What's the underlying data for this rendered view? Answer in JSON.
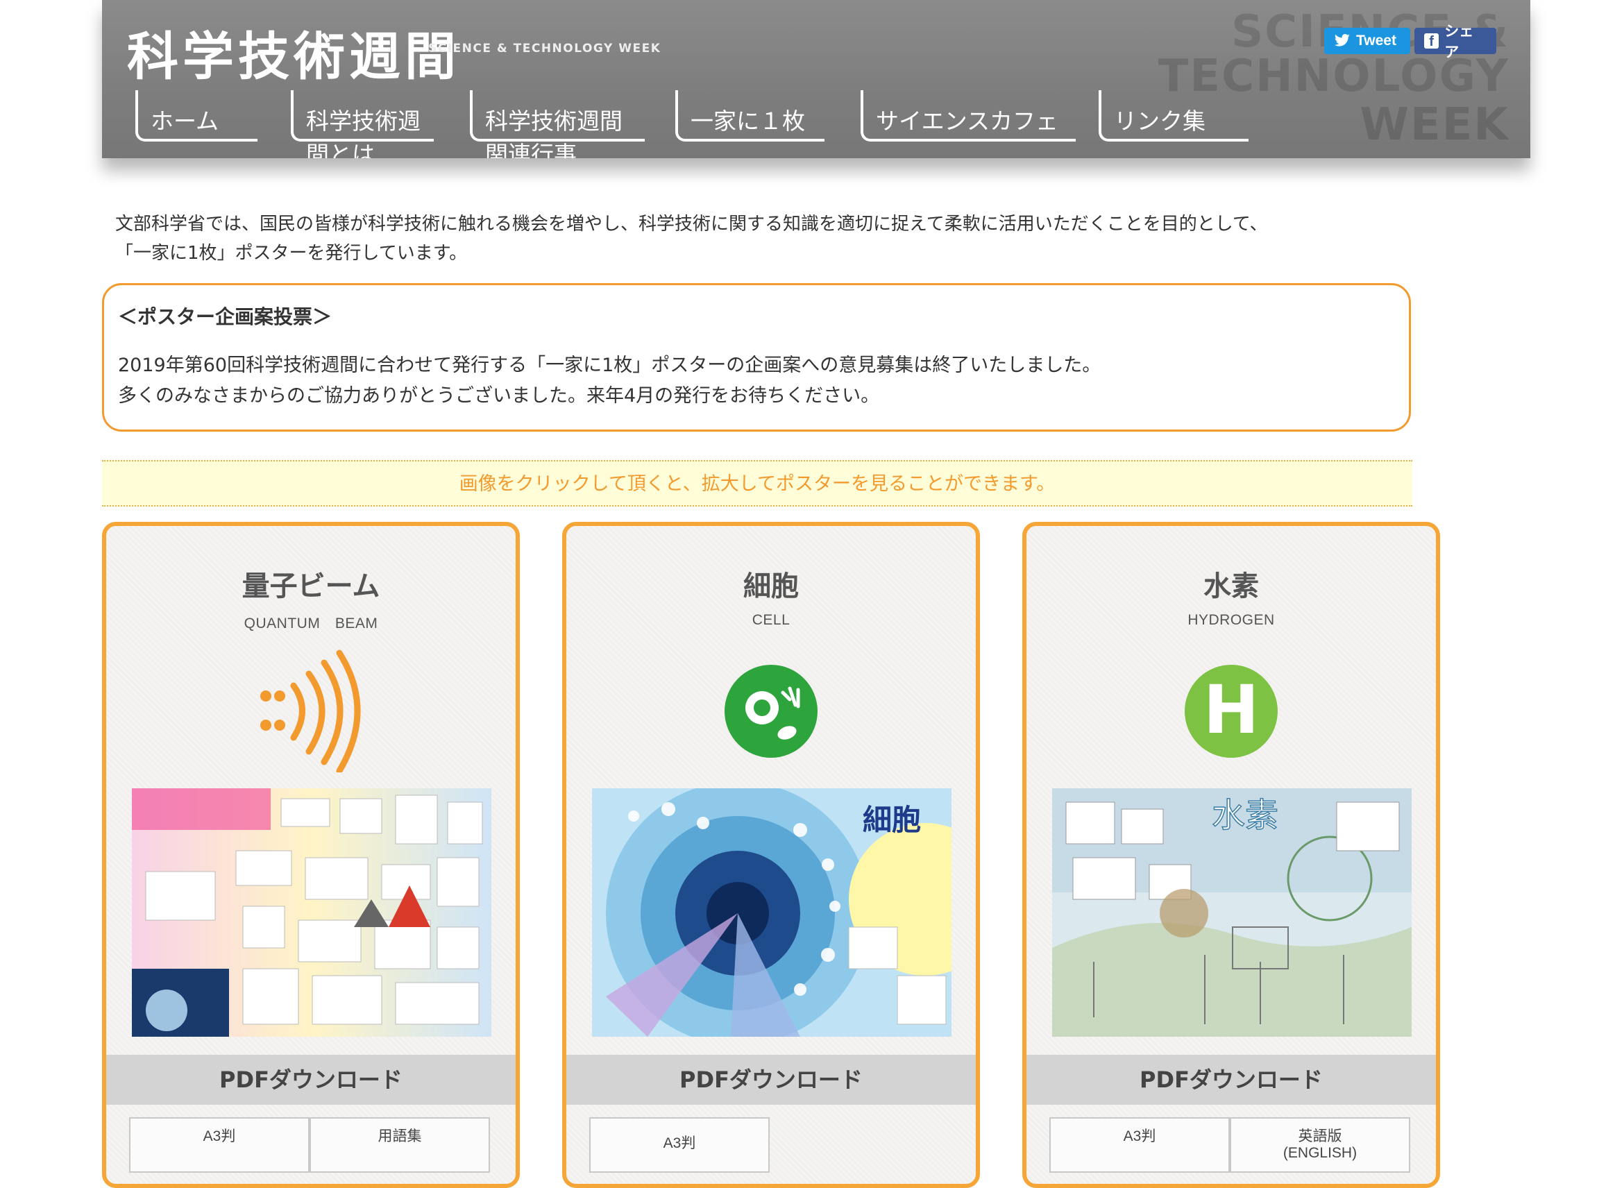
{
  "header": {
    "logo_title": "科学技術週間",
    "logo_subtitle": "SCIENCE & TECHNOLOGY WEEK",
    "bg_word_1": "SCIENCE &",
    "bg_word_2": "TECHNOLOGY",
    "bg_word_3": "WEEK",
    "tweet_label": "Tweet",
    "share_label": "シェア"
  },
  "nav": {
    "items": [
      {
        "label": "ホーム"
      },
      {
        "label": "科学技術週間とは"
      },
      {
        "label": "科学技術週間関連行事"
      },
      {
        "label": "一家に１枚"
      },
      {
        "label": "サイエンスカフェ"
      },
      {
        "label": "リンク集"
      }
    ]
  },
  "intro": {
    "line1": "文部科学省では、国民の皆様が科学技術に触れる機会を増やし、科学技術に関する知識を適切に捉えて柔軟に活用いただくことを目的として、",
    "line2": "「一家に1枚」ポスターを発行しています。"
  },
  "notice": {
    "title": "＜ポスター企画案投票＞",
    "line1": "2019年第60回科学技術週間に合わせて発行する「一家に1枚」ポスターの企画案への意見募集は終了いたしました。",
    "line2": "多くのみなさまからのご協力ありがとうございました。来年4月の発行をお待ちください。"
  },
  "hint": "画像をクリックして頂くと、拡大してポスターを見ることができます。",
  "cards": [
    {
      "title": "量子ビーム",
      "subtitle": "QUANTUM　BEAM",
      "icon": "quantum-beam-icon",
      "pdf_label": "PDFダウンロード",
      "buttons": [
        "A3判",
        "用語集"
      ]
    },
    {
      "title": "細胞",
      "subtitle": "CELL",
      "icon": "cell-icon",
      "pdf_label": "PDFダウンロード",
      "buttons": [
        "A3判"
      ]
    },
    {
      "title": "水素",
      "subtitle": "HYDROGEN",
      "icon": "hydrogen-icon",
      "icon_letter": "H",
      "pdf_label": "PDFダウンロード",
      "buttons": [
        "A3判",
        "英語版",
        "(ENGLISH)"
      ]
    }
  ],
  "colors": {
    "header_gray": "#808080",
    "accent_orange": "#f39a2e",
    "card_border": "#f5a637",
    "hint_bg": "#fffdd8",
    "tweet_blue": "#1b95e0",
    "facebook_blue": "#3b5998",
    "cell_green": "#2ea43c",
    "hydrogen_green": "#7dc242"
  }
}
